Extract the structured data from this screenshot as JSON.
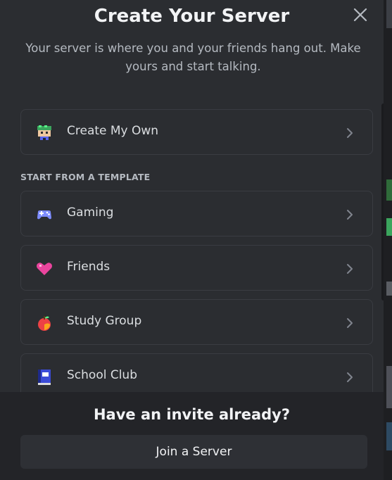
{
  "modal": {
    "title": "Create Your Server",
    "subtitle": "Your server is where you and your friends hang out. Make yours and start talking."
  },
  "primary_option": {
    "label": "Create My Own",
    "icon": "create-own-icon"
  },
  "templates": {
    "heading": "START FROM A TEMPLATE",
    "items": [
      {
        "label": "Gaming",
        "icon": "gamepad-icon"
      },
      {
        "label": "Friends",
        "icon": "heart-icon"
      },
      {
        "label": "Study Group",
        "icon": "apple-icon"
      },
      {
        "label": "School Club",
        "icon": "book-icon"
      }
    ]
  },
  "footer": {
    "heading": "Have an invite already?",
    "join_label": "Join a Server"
  },
  "colors": {
    "modal_bg": "#2b2d31",
    "footer_bg": "#232428",
    "card_border": "#3a3c42",
    "text_primary": "#f2f3f5",
    "text_secondary": "#b5bac1"
  }
}
